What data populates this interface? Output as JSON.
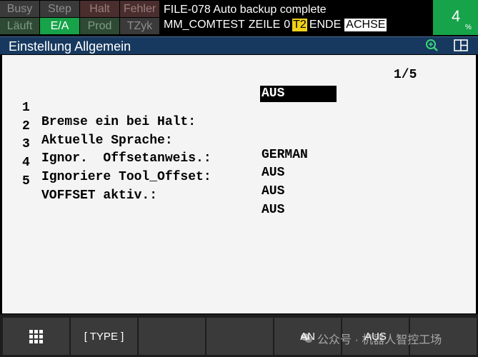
{
  "status_indicators": [
    {
      "label": "Busy",
      "active": false
    },
    {
      "label": "Step",
      "active": false
    },
    {
      "label": "Halt",
      "active": false
    },
    {
      "label": "Fehler",
      "active": false
    },
    {
      "label": "Läuft",
      "active": false
    },
    {
      "label": "E/A",
      "active": true
    },
    {
      "label": "Prod",
      "active": false
    },
    {
      "label": "TZyk",
      "active": false
    }
  ],
  "message": {
    "line1": "FILE-078 Auto backup complete",
    "program": "MM_COMTEST",
    "line_label": "ZEILE",
    "line_number": "0",
    "mode": "T2",
    "state": "ENDE",
    "axis": "ACHSE"
  },
  "override": {
    "value": "4",
    "unit": "%"
  },
  "title_bar": {
    "title": "Einstellung Allgemein",
    "icons": [
      "zoom-icon",
      "split-screen-icon"
    ]
  },
  "content": {
    "page_indicator": "1/5",
    "settings": [
      {
        "number": "1",
        "label": "Bremse ein bei Halt:",
        "value": "AUS"
      },
      {
        "number": "2",
        "label": "Aktuelle Sprache:",
        "value": "GERMAN"
      },
      {
        "number": "3",
        "label": "Ignor.  Offsetanweis.:",
        "value": "AUS"
      },
      {
        "number": "4",
        "label": "Ignoriere Tool_Offset:",
        "value": "AUS"
      },
      {
        "number": "5",
        "label": "VOFFSET aktiv.:",
        "value": "AUS"
      }
    ]
  },
  "function_keys": [
    {
      "label": "",
      "icon": "menu-grid-icon"
    },
    {
      "label": "[ TYPE ]"
    },
    {
      "label": ""
    },
    {
      "label": ""
    },
    {
      "label": "AN"
    },
    {
      "label": "AUS"
    },
    {
      "label": ""
    }
  ],
  "watermark": {
    "text": "公众号 · 机器人智控工场"
  },
  "colors": {
    "green_active": "#16a34a",
    "title_blue": "#17395f",
    "mode_yellow": "#f2d21a",
    "content_bg": "#f4f4f4"
  }
}
